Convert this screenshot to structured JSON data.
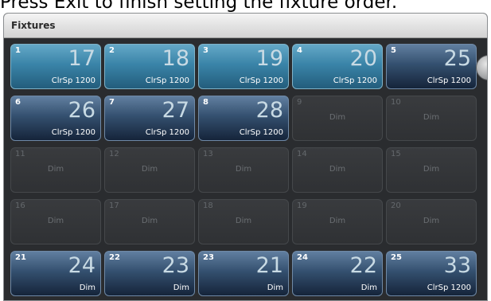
{
  "caption": "Press Exit to finish setting the fixture order.",
  "panel": {
    "title": "Fixtures"
  },
  "tiles": [
    {
      "idx": "1",
      "num": "17",
      "label": "ClrSp 1200",
      "style": "teal"
    },
    {
      "idx": "2",
      "num": "18",
      "label": "ClrSp 1200",
      "style": "teal"
    },
    {
      "idx": "3",
      "num": "19",
      "label": "ClrSp 1200",
      "style": "teal"
    },
    {
      "idx": "4",
      "num": "20",
      "label": "ClrSp 1200",
      "style": "teal"
    },
    {
      "idx": "5",
      "num": "25",
      "label": "ClrSp 1200",
      "style": "blue"
    },
    {
      "idx": "6",
      "num": "26",
      "label": "ClrSp 1200",
      "style": "blue"
    },
    {
      "idx": "7",
      "num": "27",
      "label": "ClrSp 1200",
      "style": "blue"
    },
    {
      "idx": "8",
      "num": "28",
      "label": "ClrSp 1200",
      "style": "blue"
    },
    {
      "idx": "9",
      "num": "",
      "label": "Dim",
      "style": "dim"
    },
    {
      "idx": "10",
      "num": "",
      "label": "Dim",
      "style": "dim"
    },
    {
      "idx": "11",
      "num": "",
      "label": "Dim",
      "style": "dim"
    },
    {
      "idx": "12",
      "num": "",
      "label": "Dim",
      "style": "dim"
    },
    {
      "idx": "13",
      "num": "",
      "label": "Dim",
      "style": "dim"
    },
    {
      "idx": "14",
      "num": "",
      "label": "Dim",
      "style": "dim"
    },
    {
      "idx": "15",
      "num": "",
      "label": "Dim",
      "style": "dim"
    },
    {
      "idx": "16",
      "num": "",
      "label": "Dim",
      "style": "dim"
    },
    {
      "idx": "17",
      "num": "",
      "label": "Dim",
      "style": "dim"
    },
    {
      "idx": "18",
      "num": "",
      "label": "Dim",
      "style": "dim"
    },
    {
      "idx": "19",
      "num": "",
      "label": "Dim",
      "style": "dim"
    },
    {
      "idx": "20",
      "num": "",
      "label": "Dim",
      "style": "dim"
    },
    {
      "idx": "21",
      "num": "24",
      "label": "Dim",
      "style": "blue"
    },
    {
      "idx": "22",
      "num": "23",
      "label": "Dim",
      "style": "blue"
    },
    {
      "idx": "23",
      "num": "21",
      "label": "Dim",
      "style": "blue"
    },
    {
      "idx": "24",
      "num": "22",
      "label": "Dim",
      "style": "blue"
    },
    {
      "idx": "25",
      "num": "33",
      "label": "ClrSp 1200",
      "style": "blue"
    }
  ]
}
